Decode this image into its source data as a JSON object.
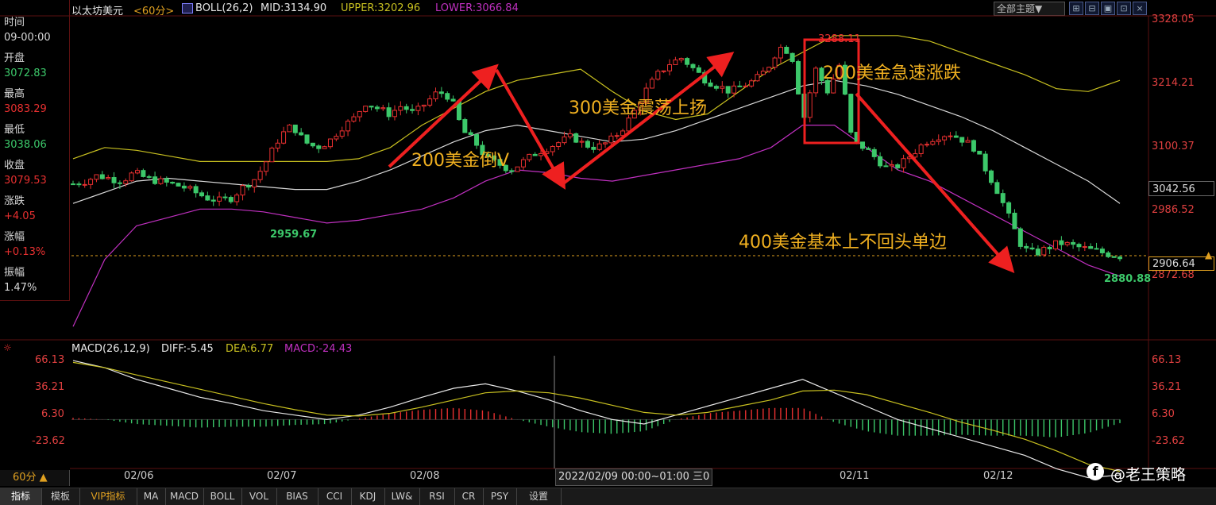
{
  "header": {
    "instrument": "以太坊美元",
    "period": "<60分>",
    "indicator": "BOLL(26,2)",
    "mid": "MID:3134.90",
    "upper": "UPPER:3202.96",
    "lower": "LOWER:3066.84",
    "theme_button": "全部主题▼"
  },
  "sidebar": {
    "time_label": "时间",
    "time_value": "09-00:00",
    "open_label": "开盘",
    "open_value": "3072.83",
    "high_label": "最高",
    "high_value": "3083.29",
    "low_label": "最低",
    "low_value": "3038.06",
    "close_label": "收盘",
    "close_value": "3079.53",
    "change_label": "涨跌",
    "change_value": "+4.05",
    "pct_label": "涨幅",
    "pct_value": "+0.13%",
    "amp_label": "振幅",
    "amp_value": "1.47%"
  },
  "price_axis": [
    "3328.05",
    "3214.21",
    "3100.37",
    "2986.52",
    "2872.68"
  ],
  "current_price_box": "3042.56",
  "last_price_tag": "2906.64",
  "price_markers": {
    "low_left": "2959.67",
    "low_right": "2880.88",
    "high_mid": "3288.11"
  },
  "macd": {
    "title": "MACD(26,12,9)",
    "diff": "DIFF:-5.45",
    "dea": "DEA:6.77",
    "macd": "MACD:-24.43",
    "axis": [
      "66.13",
      "36.21",
      "6.30",
      "-23.62"
    ]
  },
  "annotations": {
    "a1": "200美金倒V",
    "a2": "300美金震荡上扬",
    "a3": "200美金急速涨跌",
    "a4": "400美金基本上不回头单边"
  },
  "time_axis": {
    "period_button": "60分 ▲",
    "dates": [
      "02/06",
      "02/07",
      "02/08",
      "02/11",
      "02/12"
    ],
    "cursor_label": "2022/02/09 00:00~01:00 三",
    "cursor_label_tail": "0"
  },
  "watermark": "@老王策略",
  "bottom_tabs": [
    "指标",
    "模板",
    "VIP指标",
    "MA",
    "MACD",
    "BOLL",
    "VOL",
    "BIAS",
    "CCI",
    "KDJ",
    "LW&",
    "RSI",
    "CR",
    "PSY",
    "设置"
  ],
  "colors": {
    "up": "#e83030",
    "down": "#3cc86a",
    "boll_mid": "#d8d8d8",
    "boll_upper": "#c8c020",
    "boll_lower": "#c030c0",
    "annotation": "#f0b020",
    "arrow": "#ee2020"
  },
  "chart_data": [
    {
      "type": "candlestick",
      "title": "以太坊美元 60分 BOLL(26,2)",
      "x": [
        "02/06",
        "02/07",
        "02/08",
        "02/09",
        "02/11",
        "02/12"
      ],
      "y_ticks": [
        3328.05,
        3214.21,
        3100.37,
        2986.52,
        2872.68
      ],
      "ylim": [
        2700,
        3340
      ],
      "close_path": [
        3035,
        3040,
        3050,
        3045,
        3040,
        3055,
        3045,
        3040,
        3035,
        3030,
        3020,
        3010,
        3005,
        3010,
        3030,
        3045,
        3080,
        3120,
        3140,
        3110,
        3100,
        3110,
        3135,
        3150,
        3180,
        3170,
        3160,
        3175,
        3160,
        3180,
        3200,
        3190,
        3130,
        3110,
        3080,
        3070,
        3060,
        3075,
        3090,
        3100,
        3110,
        3120,
        3105,
        3100,
        3110,
        3130,
        3160,
        3200,
        3230,
        3250,
        3260,
        3240,
        3220,
        3210,
        3200,
        3210,
        3220,
        3240,
        3280,
        3270,
        3150,
        3240,
        3200,
        3250,
        3110,
        3100,
        3080,
        3060,
        3070,
        3090,
        3110,
        3120,
        3125,
        3115,
        3100,
        3060,
        3020,
        2970,
        2920,
        2910,
        2920,
        2930,
        2925,
        2920,
        2915,
        2910,
        2906
      ],
      "series": [
        {
          "name": "UPPER",
          "values": [
            3080,
            3100,
            3095,
            3085,
            3075,
            3075,
            3075,
            3075,
            3075,
            3080,
            3100,
            3140,
            3170,
            3200,
            3220,
            3230,
            3240,
            3200,
            3165,
            3150,
            3160,
            3200,
            3240,
            3270,
            3300,
            3300,
            3300,
            3290,
            3270,
            3250,
            3230,
            3205,
            3200,
            3220
          ]
        },
        {
          "name": "MID",
          "values": [
            3000,
            3020,
            3040,
            3045,
            3040,
            3035,
            3030,
            3025,
            3025,
            3040,
            3060,
            3085,
            3110,
            3130,
            3140,
            3130,
            3120,
            3110,
            3115,
            3130,
            3150,
            3170,
            3190,
            3210,
            3220,
            3210,
            3195,
            3175,
            3155,
            3130,
            3100,
            3070,
            3040,
            3000
          ]
        },
        {
          "name": "LOWER",
          "values": [
            2780,
            2900,
            2960,
            2975,
            2990,
            2990,
            2985,
            2975,
            2965,
            2970,
            2980,
            2990,
            3010,
            3040,
            3060,
            3055,
            3045,
            3040,
            3050,
            3060,
            3070,
            3080,
            3100,
            3140,
            3140,
            3100,
            3060,
            3040,
            3010,
            2980,
            2950,
            2920,
            2890,
            2870
          ]
        }
      ]
    },
    {
      "type": "bar",
      "title": "MACD(26,12,9)",
      "y_ticks": [
        66.13,
        36.21,
        6.3,
        -23.62
      ],
      "series": [
        {
          "name": "DIFF",
          "values": [
            66,
            58,
            45,
            35,
            25,
            18,
            10,
            5,
            0,
            5,
            14,
            25,
            35,
            40,
            32,
            22,
            10,
            0,
            -5,
            5,
            15,
            25,
            35,
            45,
            30,
            15,
            0,
            -10,
            -20,
            -30,
            -40,
            -55,
            -65,
            -62
          ]
        },
        {
          "name": "DEA",
          "values": [
            64,
            58,
            50,
            42,
            34,
            26,
            18,
            11,
            5,
            4,
            7,
            14,
            22,
            30,
            32,
            30,
            24,
            16,
            8,
            5,
            8,
            15,
            22,
            32,
            33,
            28,
            18,
            8,
            -3,
            -12,
            -22,
            -35,
            -50,
            -58
          ]
        },
        {
          "name": "MACD",
          "values": [
            2,
            0,
            -5,
            -7,
            -9,
            -8,
            -8,
            -6,
            -5,
            1,
            7,
            11,
            13,
            10,
            0,
            -8,
            -14,
            -16,
            -13,
            0,
            7,
            10,
            13,
            13,
            -3,
            -13,
            -18,
            -18,
            -17,
            -18,
            -18,
            -20,
            -15,
            -4
          ]
        }
      ]
    }
  ]
}
